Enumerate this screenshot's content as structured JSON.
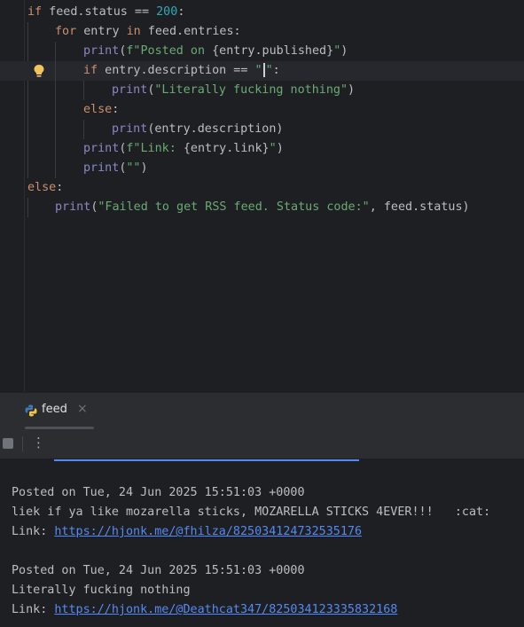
{
  "editor": {
    "lines": [
      {
        "kw": "if",
        "a": " feed.status == ",
        "num": "200",
        "b": ":"
      },
      {
        "kw": "for",
        "a": " entry ",
        "kw2": "in",
        "b": " feed.entries:"
      },
      {
        "fn": "print",
        "a": "(",
        "s1": "f\"Posted on ",
        "a2": "{entry.published}",
        "s2": "\"",
        "b": ")"
      },
      {
        "kw": "if",
        "a": " entry.description == ",
        "s1": "\"",
        "s2": "\"",
        "b": ":"
      },
      {
        "fn": "print",
        "a": "(",
        "s1": "\"Literally fucking nothing\"",
        "b": ")"
      },
      {
        "kw": "else",
        "b": ":"
      },
      {
        "fn": "print",
        "a": "(entry.description)"
      },
      {
        "fn": "print",
        "a": "(",
        "s1": "f\"Link: ",
        "a2": "{entry.link}",
        "s2": "\"",
        "b": ")"
      },
      {
        "fn": "print",
        "a": "(",
        "s1": "\"\"",
        "b": ")"
      },
      {
        "kw": "else",
        "b": ":"
      },
      {
        "fn": "print",
        "a": "(",
        "s1": "\"Failed to get RSS feed. Status code:\"",
        "b": ", feed.status)"
      }
    ]
  },
  "tool_window": {
    "tab_label": "feed",
    "close_glyph": "×",
    "more_glyph": "⋮"
  },
  "console": {
    "lines": [
      {
        "text": ""
      },
      {
        "text": "Posted on Tue, 24 Jun 2025 15:51:03 +0000"
      },
      {
        "text": "liek if ya like mozarella sticks, MOZARELLA STICKS 4EVER!!!   :cat:"
      },
      {
        "prefix": "Link: ",
        "link": "https://hjonk.me/@fhilza/825034124732535176"
      },
      {
        "text": ""
      },
      {
        "text": "Posted on Tue, 24 Jun 2025 15:51:03 +0000"
      },
      {
        "text": "Literally fucking nothing"
      },
      {
        "prefix": "Link: ",
        "link": "https://hjonk.me/@Deathcat347/825034123335832168"
      }
    ]
  },
  "icons": [
    "lightbulb-icon",
    "python-icon",
    "close-icon",
    "stop-icon",
    "more-options-icon"
  ]
}
